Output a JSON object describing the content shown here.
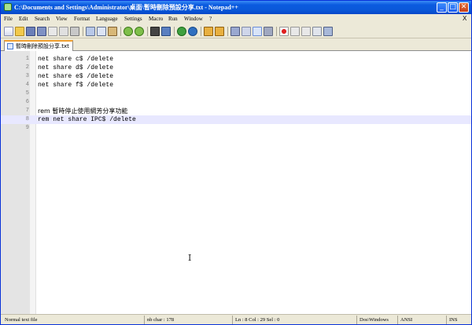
{
  "window": {
    "title": "C:\\Documents and Settings\\Administrator\\桌面\\暫時刪除預設分享.txt - Notepad++",
    "controls": {
      "minimize": "_",
      "maximize": "□",
      "close": "✕"
    }
  },
  "menu": {
    "items": [
      "File",
      "Edit",
      "Search",
      "View",
      "Format",
      "Language",
      "Settings",
      "Macro",
      "Run",
      "Window",
      "?"
    ],
    "close_doc": "X"
  },
  "toolbar": {
    "icons": [
      "new-file-icon",
      "open-file-icon",
      "save-icon",
      "save-all-icon",
      "close-icon",
      "close-all-icon",
      "print-icon",
      "cut-icon",
      "copy-icon",
      "paste-icon",
      "undo-icon",
      "redo-icon",
      "find-icon",
      "replace-icon",
      "zoom-in-icon",
      "zoom-out-icon",
      "sync-vertical-icon",
      "sync-horizontal-icon",
      "word-wrap-icon",
      "show-all-chars-icon",
      "indent-guide-icon",
      "user-lang-icon",
      "record-macro-icon",
      "stop-record-icon",
      "play-macro-icon",
      "run-macro-multiple-icon",
      "save-macro-icon"
    ]
  },
  "tab": {
    "label": "暫時刪除預設分享.txt"
  },
  "editor": {
    "lines": [
      {
        "num": "1",
        "text": "net share c$ /delete"
      },
      {
        "num": "2",
        "text": "net share d$ /delete"
      },
      {
        "num": "3",
        "text": "net share e$ /delete"
      },
      {
        "num": "4",
        "text": "net share f$ /delete"
      },
      {
        "num": "5",
        "text": ""
      },
      {
        "num": "6",
        "text": ""
      },
      {
        "num": "7",
        "text": "rem 暫時停止使用網芳分享功能"
      },
      {
        "num": "8",
        "text": "rem net share IPC$ /delete"
      },
      {
        "num": "9",
        "text": ""
      }
    ],
    "current_line": 8,
    "cursor_glyph": "I"
  },
  "status": {
    "file_type": "Normal text file",
    "length": "nb char : 178",
    "position": "Ln : 8    Col : 29    Sel : 0",
    "eol": "Dos\\Windows",
    "encoding": "ANSI",
    "mode": "INS"
  }
}
